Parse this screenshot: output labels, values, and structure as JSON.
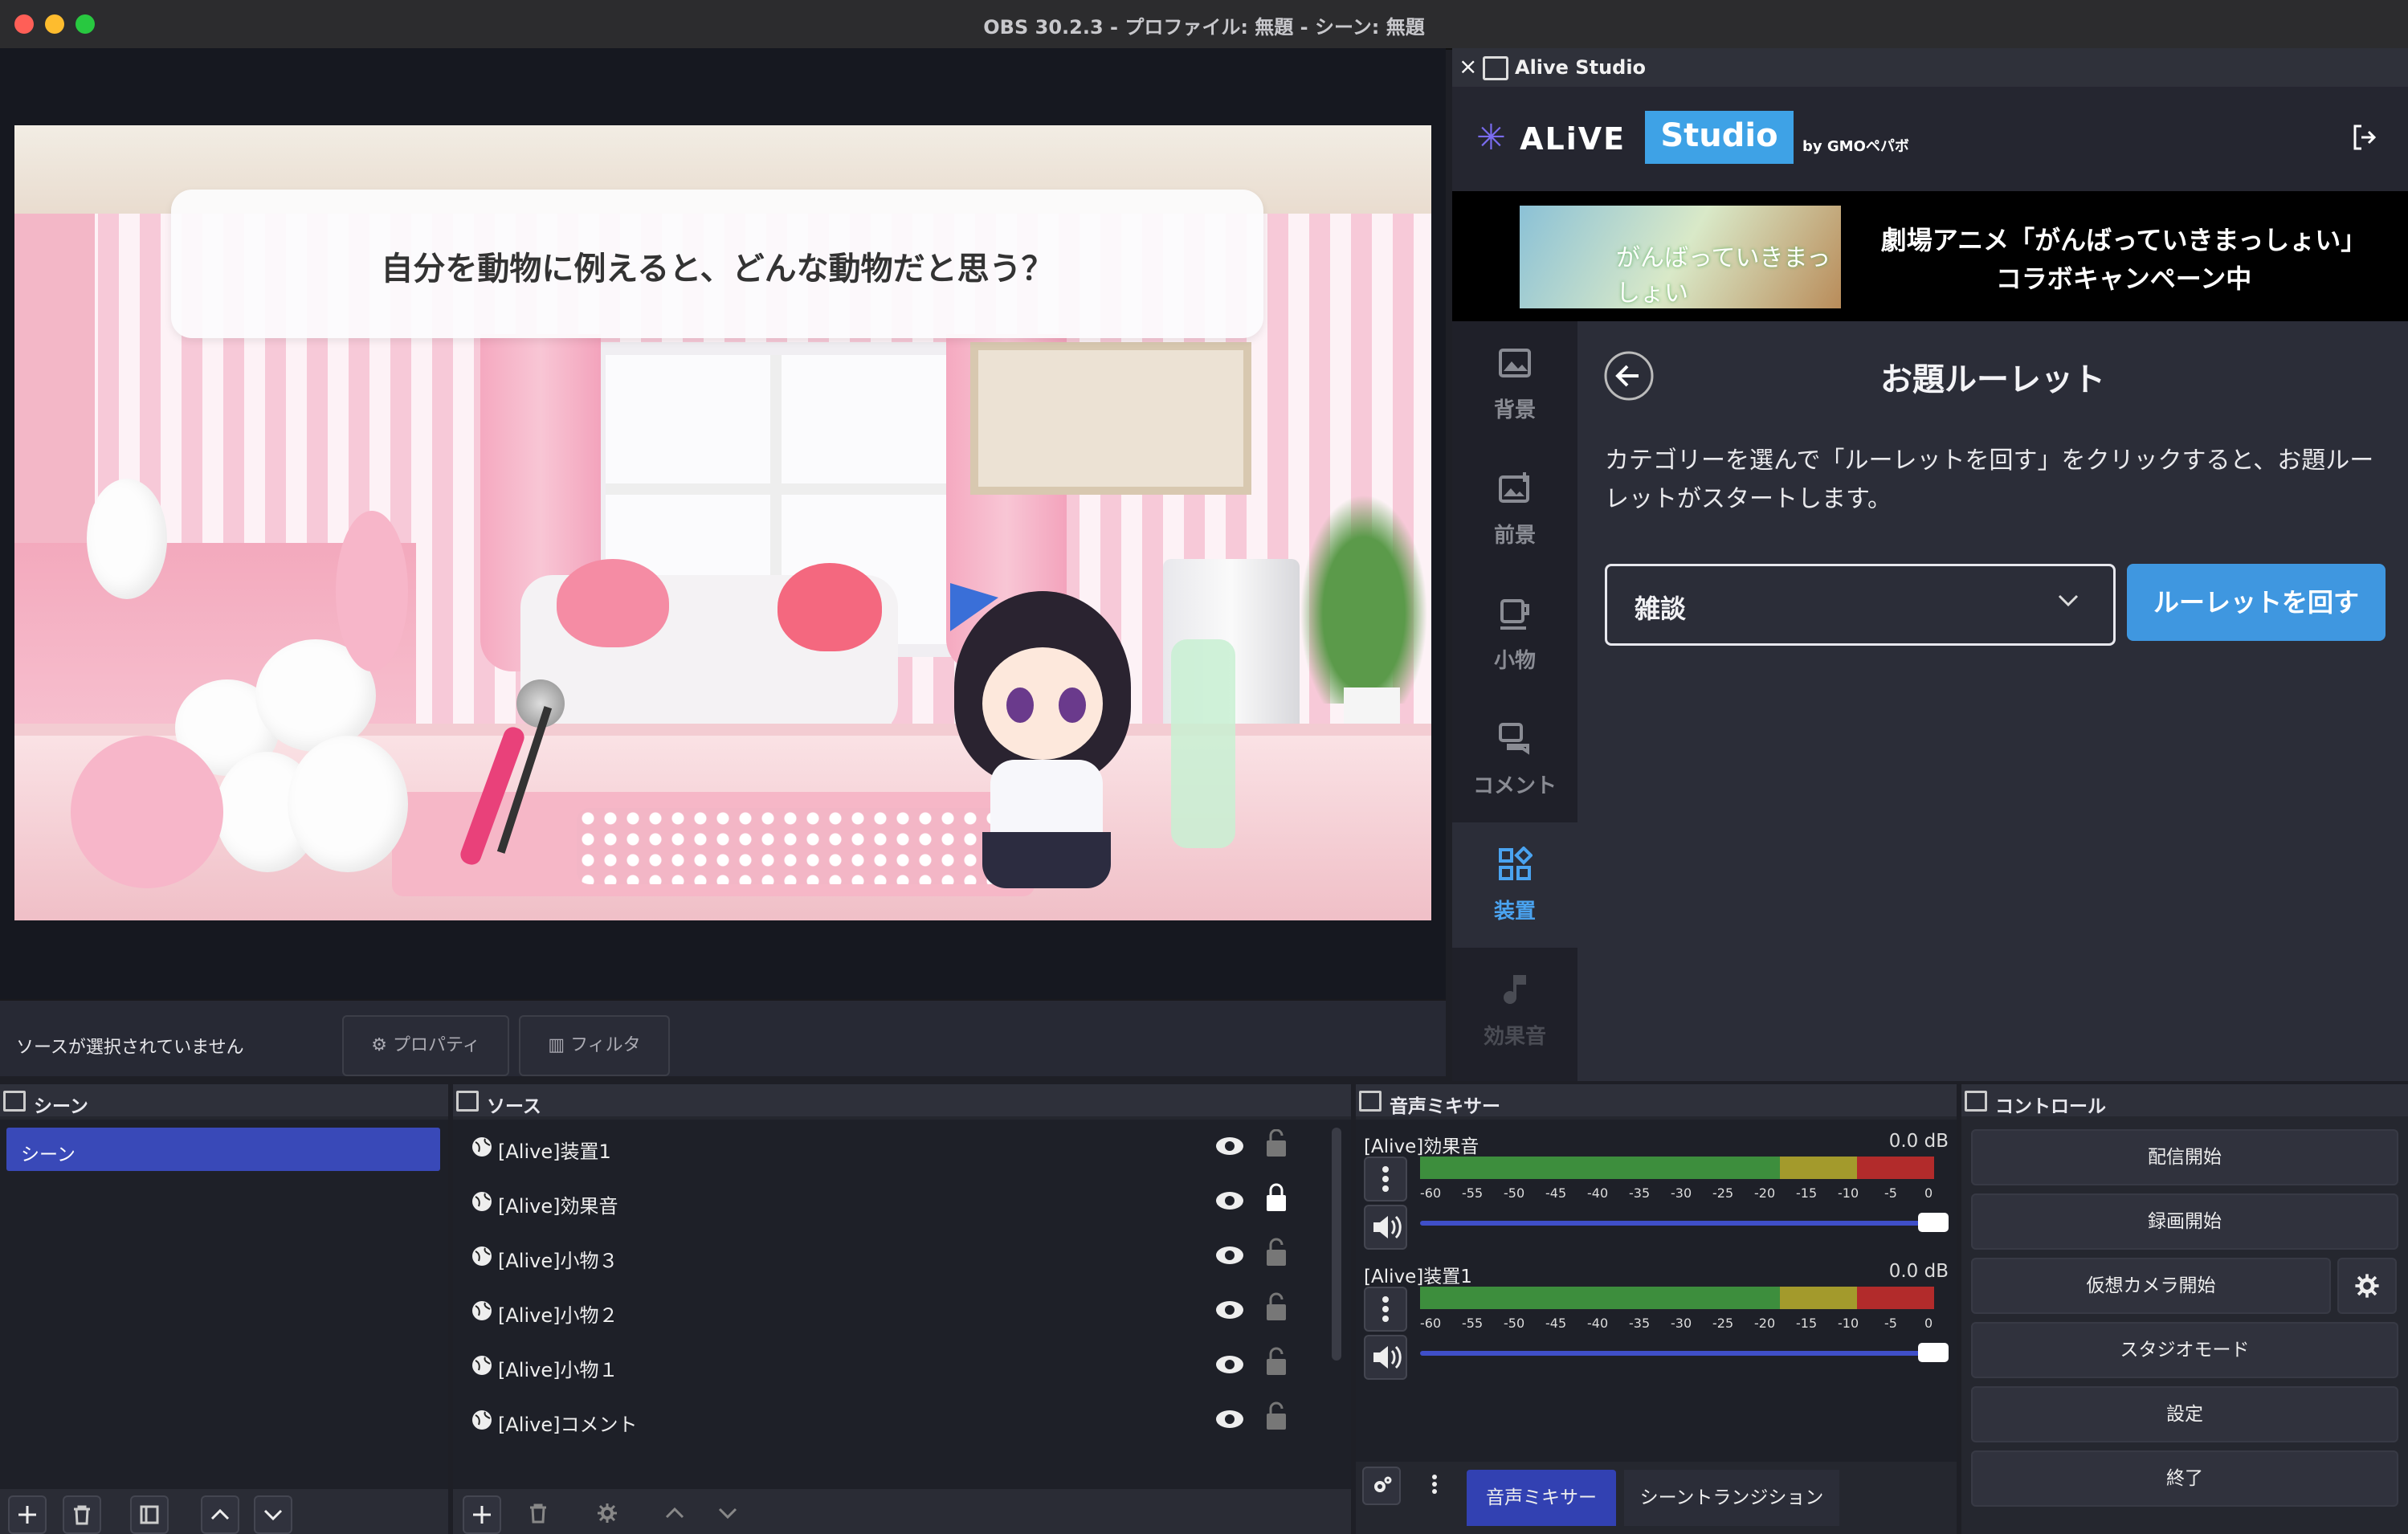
{
  "window": {
    "title": "OBS 30.2.3 - プロファイル: 無題 - シーン: 無題"
  },
  "preview": {
    "question": "自分を動物に例えると、どんな動物だと思う？"
  },
  "status": {
    "no_source": "ソースが選択されていません",
    "properties": "プロパティ",
    "filters": "フィルタ"
  },
  "dock": {
    "title": "Alive Studio",
    "logo_text": "ALiVE",
    "studio_badge": "Studio",
    "by": "by GMOペパボ",
    "banner_image_text": "がんばっていきまっしょい",
    "banner_line1": "劇場アニメ「がんばっていきまっしょい」",
    "banner_line2": "コラボキャンペーン中",
    "nav": [
      {
        "label": "背景"
      },
      {
        "label": "前景"
      },
      {
        "label": "小物"
      },
      {
        "label": "コメント"
      },
      {
        "label": "装置"
      },
      {
        "label": "効果音"
      }
    ],
    "content_title": "お題ルーレット",
    "description": "カテゴリーを選んで「ルーレットを回す」をクリックすると、お題ルーレットがスタートします。",
    "category_value": "雑談",
    "spin_button": "ルーレットを回す",
    "accent": "#3f97e0"
  },
  "scenes": {
    "title": "シーン",
    "items": [
      "シーン"
    ]
  },
  "sources": {
    "title": "ソース",
    "items": [
      "[Alive]装置1",
      "[Alive]効果音",
      "[Alive]小物３",
      "[Alive]小物２",
      "[Alive]小物１",
      "[Alive]コメント"
    ]
  },
  "mixer": {
    "title": "音声ミキサー",
    "channels": [
      {
        "name": "[Alive]効果音",
        "db": "0.0 dB"
      },
      {
        "name": "[Alive]装置1",
        "db": "0.0 dB"
      }
    ],
    "ticks": [
      "-60",
      "-55",
      "-50",
      "-45",
      "-40",
      "-35",
      "-30",
      "-25",
      "-20",
      "-15",
      "-10",
      "-5",
      "0"
    ]
  },
  "controls": {
    "title": "コントロール",
    "start_stream": "配信開始",
    "start_record": "録画開始",
    "start_vcam": "仮想カメラ開始",
    "studio_mode": "スタジオモード",
    "settings": "設定",
    "exit": "終了"
  },
  "tabs": {
    "mixer": "音声ミキサー",
    "transitions": "シーントランジション"
  }
}
